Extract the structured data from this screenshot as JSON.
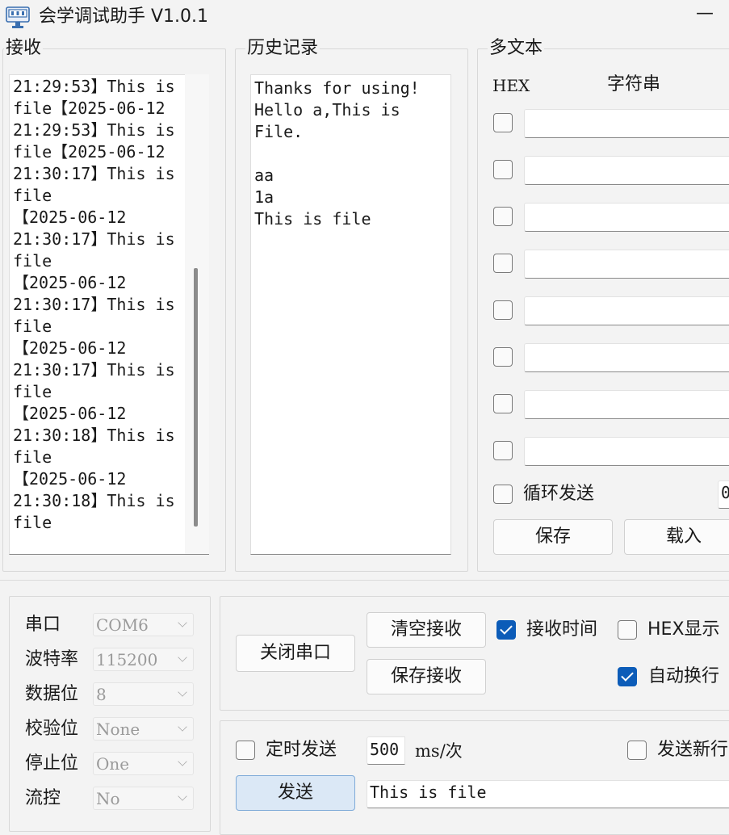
{
  "window": {
    "title": "会学调试助手 V1.0.1",
    "minimize_glyph": "—"
  },
  "receive": {
    "label": "接收",
    "text": "21:29:53】This is\nfile【2025-06-12\n21:29:53】This is\nfile【2025-06-12\n21:30:17】This is\nfile\n【2025-06-12\n21:30:17】This is\nfile\n【2025-06-12\n21:30:17】This is\nfile\n【2025-06-12\n21:30:17】This is\nfile\n【2025-06-12\n21:30:18】This is\nfile\n【2025-06-12\n21:30:18】This is\nfile"
  },
  "history": {
    "label": "历史记录",
    "text": "Thanks for using!\nHello a,This is\nFile.\n\naa\n1a\nThis is file"
  },
  "multi_text": {
    "label": "多文本",
    "hex_header": "HEX",
    "string_header": "字符串",
    "rows": [
      {
        "hex": false,
        "value": ""
      },
      {
        "hex": false,
        "value": ""
      },
      {
        "hex": false,
        "value": ""
      },
      {
        "hex": false,
        "value": ""
      },
      {
        "hex": false,
        "value": ""
      },
      {
        "hex": false,
        "value": ""
      },
      {
        "hex": false,
        "value": ""
      },
      {
        "hex": false,
        "value": ""
      }
    ],
    "loop_send_label": "循环发送",
    "loop_send_checked": false,
    "loop_interval": "0",
    "save_label": "保存",
    "load_label": "载入"
  },
  "serial": {
    "port_label": "串口",
    "port_value": "COM6",
    "baud_label": "波特率",
    "baud_value": "115200",
    "databits_label": "数据位",
    "databits_value": "8",
    "parity_label": "校验位",
    "parity_value": "None",
    "stopbits_label": "停止位",
    "stopbits_value": "One",
    "flow_label": "流控",
    "flow_value": "No"
  },
  "controls": {
    "close_port_label": "关闭串口",
    "clear_receive_label": "清空接收",
    "save_receive_label": "保存接收",
    "receive_time_label": "接收时间",
    "receive_time_checked": true,
    "hex_display_label": "HEX显示",
    "hex_display_checked": false,
    "auto_wrap_label": "自动换行",
    "auto_wrap_checked": true
  },
  "send": {
    "timed_send_label": "定时发送",
    "timed_send_checked": false,
    "interval_value": "500",
    "interval_unit": "ms/次",
    "send_newline_label": "发送新行",
    "send_newline_checked": false,
    "send_button_label": "发送",
    "send_text": "This is file"
  },
  "colors": {
    "accent": "#0c5cb8",
    "background": "#f3f3f3",
    "primary_button": "#dbe8f6"
  },
  "icons": {
    "app": "serial-port-icon"
  }
}
